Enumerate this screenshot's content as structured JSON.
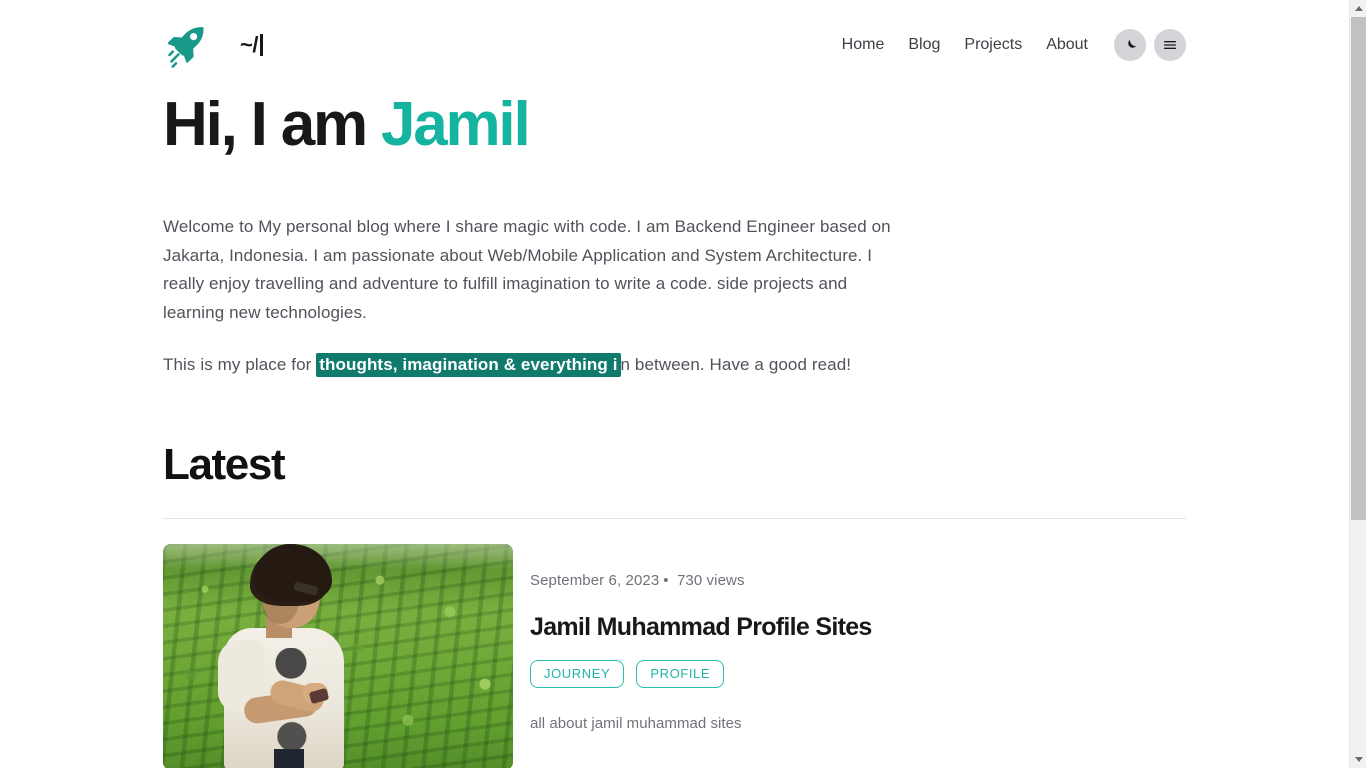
{
  "header": {
    "brand": {
      "logo_icon": "rocket-icon",
      "text": "~/",
      "caret": ""
    },
    "nav_links": [
      {
        "label": "Home"
      },
      {
        "label": "Blog"
      },
      {
        "label": "Projects"
      },
      {
        "label": "About"
      }
    ],
    "theme_toggle": {
      "icon": "moon-icon",
      "label": ""
    },
    "menu_button": {
      "icon": "hamburger-menu-icon",
      "label": ""
    }
  },
  "hero": {
    "title_prefix": "Hi, I am ",
    "title_accent": "Jamil",
    "paragraph_1": "Welcome to My personal blog where I share magic with code. I am Backend Engineer based on Jakarta, Indonesia. I am passionate about Web/Mobile Application and System Architecture. I really enjoy travelling and adventure to fulfill imagination to write a code. side projects and learning new technologies.",
    "paragraph_2_before": "This is my place for ",
    "paragraph_2_highlight": "thoughts, imagination & everything i",
    "paragraph_2_after": "n between. Have a good read!"
  },
  "latest": {
    "heading": "Latest",
    "posts": [
      {
        "thumbnail_alt": "person standing in a green tea plantation looking at a phone",
        "date": "September 6, 2023",
        "separator": "•",
        "views": "730 views",
        "title": "Jamil Muhammad Profile Sites",
        "tags": [
          "JOURNEY",
          "PROFILE"
        ],
        "description": "all about jamil muhammad sites"
      }
    ]
  },
  "colors": {
    "accent_teal": "#14b4a0",
    "highlight_bg": "#107a6d",
    "tag_border": "#2bbfae",
    "text_dark": "#18181b",
    "text_muted": "#52525b"
  },
  "scrollbar": {
    "up_arrow": "scroll-up-arrow",
    "down_arrow": "scroll-down-arrow",
    "thumb": "scrollbar-thumb"
  }
}
